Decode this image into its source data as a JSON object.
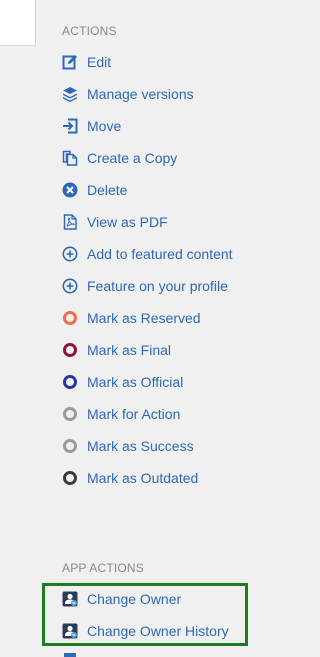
{
  "sections": {
    "actions_title": "ACTIONS",
    "app_actions_title": "APP ACTIONS"
  },
  "actions": [
    {
      "label": "Edit",
      "icon": "edit-icon"
    },
    {
      "label": "Manage versions",
      "icon": "layers-icon"
    },
    {
      "label": "Move",
      "icon": "move-icon"
    },
    {
      "label": "Create a Copy",
      "icon": "copy-icon"
    },
    {
      "label": "Delete",
      "icon": "delete-icon"
    },
    {
      "label": "View as PDF",
      "icon": "pdf-icon"
    },
    {
      "label": "Add to featured content",
      "icon": "plus-circle-icon"
    },
    {
      "label": "Feature on your profile",
      "icon": "plus-circle-icon"
    },
    {
      "label": "Mark as Reserved",
      "icon": "ring-icon",
      "color": "#f06c4e"
    },
    {
      "label": "Mark as Final",
      "icon": "ring-icon",
      "color": "#8a1538"
    },
    {
      "label": "Mark as Official",
      "icon": "ring-icon",
      "color": "#23399b"
    },
    {
      "label": "Mark for Action",
      "icon": "ring-icon",
      "color": "#9a9a9a"
    },
    {
      "label": "Mark as Success",
      "icon": "ring-icon",
      "color": "#9a9a9a"
    },
    {
      "label": "Mark as Outdated",
      "icon": "ring-icon",
      "color": "#3a3a3a"
    }
  ],
  "app_actions": [
    {
      "label": "Change Owner",
      "icon": "change-owner-icon"
    },
    {
      "label": "Change Owner History",
      "icon": "change-owner-icon"
    }
  ],
  "colors": {
    "link": "#2f68b7",
    "highlight": "#1e7d1e"
  }
}
